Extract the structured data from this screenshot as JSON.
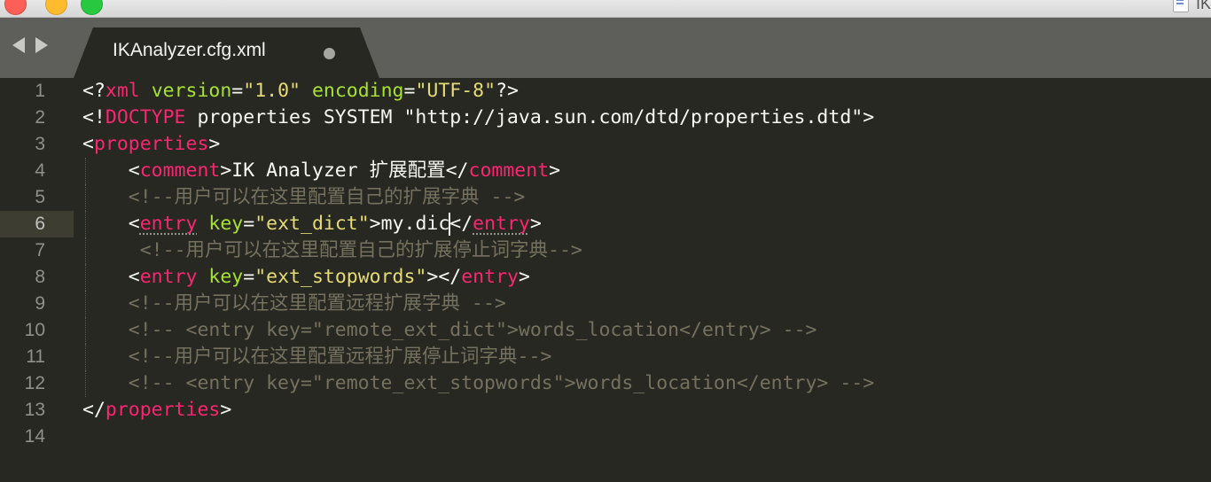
{
  "window": {
    "right_title": "IK"
  },
  "tab": {
    "title": "IKAnalyzer.cfg.xml"
  },
  "colors": {
    "tag": "#f92672",
    "attribute": "#a6e22e",
    "string": "#e6db74",
    "comment": "#75715e",
    "text": "#f8f8f2",
    "background": "#272822"
  },
  "editor": {
    "active_line": 6,
    "lines": [
      {
        "num": "1",
        "segs": [
          {
            "t": "<?",
            "c": "p"
          },
          {
            "t": "xml",
            "c": "t"
          },
          {
            "t": " ",
            "c": "p"
          },
          {
            "t": "version",
            "c": "a"
          },
          {
            "t": "=",
            "c": "p"
          },
          {
            "t": "\"1.0\"",
            "c": "s"
          },
          {
            "t": " ",
            "c": "p"
          },
          {
            "t": "encoding",
            "c": "a"
          },
          {
            "t": "=",
            "c": "p"
          },
          {
            "t": "\"UTF-8\"",
            "c": "s"
          },
          {
            "t": "?>",
            "c": "p"
          }
        ]
      },
      {
        "num": "2",
        "segs": [
          {
            "t": "<!",
            "c": "p"
          },
          {
            "t": "DOCTYPE",
            "c": "t"
          },
          {
            "t": " properties SYSTEM \"http://java.sun.com/dtd/properties.dtd\">",
            "c": "p"
          }
        ]
      },
      {
        "num": "3",
        "segs": [
          {
            "t": "<",
            "c": "p"
          },
          {
            "t": "properties",
            "c": "t"
          },
          {
            "t": ">",
            "c": "p"
          }
        ]
      },
      {
        "num": "4",
        "segs": [
          {
            "t": "    <",
            "c": "p"
          },
          {
            "t": "comment",
            "c": "t"
          },
          {
            "t": ">IK Analyzer 扩展配置</",
            "c": "p"
          },
          {
            "t": "comment",
            "c": "t"
          },
          {
            "t": ">",
            "c": "p"
          }
        ]
      },
      {
        "num": "5",
        "segs": [
          {
            "t": "    ",
            "c": "p"
          },
          {
            "t": "<!--用户可以在这里配置自己的扩展字典 -->",
            "c": "c"
          }
        ]
      },
      {
        "num": "6",
        "segs": [
          {
            "t": "    <",
            "c": "p"
          },
          {
            "t": "entry",
            "c": "t u"
          },
          {
            "t": " ",
            "c": "p"
          },
          {
            "t": "key",
            "c": "a"
          },
          {
            "t": "=",
            "c": "p"
          },
          {
            "t": "\"ext_dict\"",
            "c": "s"
          },
          {
            "t": ">my.dic",
            "c": "p"
          },
          {
            "t": "",
            "c": "cursor"
          },
          {
            "t": "</",
            "c": "p"
          },
          {
            "t": "entry",
            "c": "t u"
          },
          {
            "t": ">",
            "c": "p"
          }
        ]
      },
      {
        "num": "7",
        "segs": [
          {
            "t": "     ",
            "c": "p"
          },
          {
            "t": "<!--用户可以在这里配置自己的扩展停止词字典-->",
            "c": "c"
          }
        ]
      },
      {
        "num": "8",
        "segs": [
          {
            "t": "    <",
            "c": "p"
          },
          {
            "t": "entry",
            "c": "t"
          },
          {
            "t": " ",
            "c": "p"
          },
          {
            "t": "key",
            "c": "a"
          },
          {
            "t": "=",
            "c": "p"
          },
          {
            "t": "\"ext_stopwords\"",
            "c": "s"
          },
          {
            "t": "></",
            "c": "p"
          },
          {
            "t": "entry",
            "c": "t"
          },
          {
            "t": ">",
            "c": "p"
          }
        ]
      },
      {
        "num": "9",
        "segs": [
          {
            "t": "    ",
            "c": "p"
          },
          {
            "t": "<!--用户可以在这里配置远程扩展字典 -->",
            "c": "c"
          }
        ]
      },
      {
        "num": "10",
        "segs": [
          {
            "t": "    ",
            "c": "p"
          },
          {
            "t": "<!-- <entry key=\"remote_ext_dict\">words_location</entry> -->",
            "c": "c"
          }
        ]
      },
      {
        "num": "11",
        "segs": [
          {
            "t": "    ",
            "c": "p"
          },
          {
            "t": "<!--用户可以在这里配置远程扩展停止词字典-->",
            "c": "c"
          }
        ]
      },
      {
        "num": "12",
        "segs": [
          {
            "t": "    ",
            "c": "p"
          },
          {
            "t": "<!-- <entry key=\"remote_ext_stopwords\">words_location</entry> -->",
            "c": "c"
          }
        ]
      },
      {
        "num": "13",
        "segs": [
          {
            "t": "</",
            "c": "p"
          },
          {
            "t": "properties",
            "c": "t"
          },
          {
            "t": ">",
            "c": "p"
          }
        ]
      },
      {
        "num": "14",
        "segs": []
      }
    ]
  }
}
